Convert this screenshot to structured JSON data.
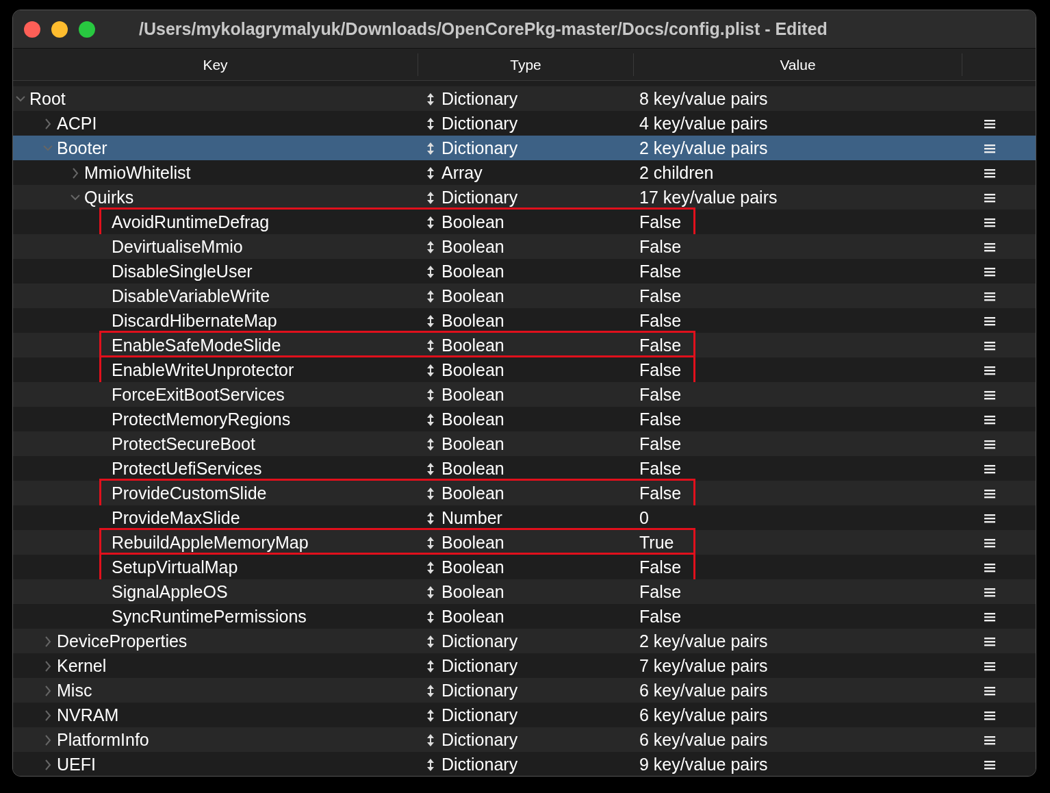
{
  "window": {
    "title": "/Users/mykolagrymalyuk/Downloads/OpenCorePkg-master/Docs/config.plist - Edited"
  },
  "table": {
    "columns": [
      "Key",
      "Type",
      "Value"
    ],
    "rows": [
      {
        "key": "Root",
        "type": "Dictionary",
        "value": "8 key/value pairs",
        "expanded": true,
        "selected": false,
        "highlighted": false,
        "children": [
          {
            "key": "ACPI",
            "type": "Dictionary",
            "value": "4 key/value pairs",
            "expanded": false,
            "selected": false,
            "highlighted": false
          },
          {
            "key": "Booter",
            "type": "Dictionary",
            "value": "2 key/value pairs",
            "expanded": true,
            "selected": true,
            "highlighted": false,
            "children": [
              {
                "key": "MmioWhitelist",
                "type": "Array",
                "value": "2 children",
                "expanded": false,
                "selected": false,
                "highlighted": false
              },
              {
                "key": "Quirks",
                "type": "Dictionary",
                "value": "17 key/value pairs",
                "expanded": true,
                "selected": false,
                "highlighted": false,
                "children": [
                  {
                    "key": "AvoidRuntimeDefrag",
                    "type": "Boolean",
                    "value": "False",
                    "selected": false,
                    "highlighted": true
                  },
                  {
                    "key": "DevirtualiseMmio",
                    "type": "Boolean",
                    "value": "False",
                    "selected": false,
                    "highlighted": false
                  },
                  {
                    "key": "DisableSingleUser",
                    "type": "Boolean",
                    "value": "False",
                    "selected": false,
                    "highlighted": false
                  },
                  {
                    "key": "DisableVariableWrite",
                    "type": "Boolean",
                    "value": "False",
                    "selected": false,
                    "highlighted": false
                  },
                  {
                    "key": "DiscardHibernateMap",
                    "type": "Boolean",
                    "value": "False",
                    "selected": false,
                    "highlighted": false
                  },
                  {
                    "key": "EnableSafeModeSlide",
                    "type": "Boolean",
                    "value": "False",
                    "selected": false,
                    "highlighted": true
                  },
                  {
                    "key": "EnableWriteUnprotector",
                    "type": "Boolean",
                    "value": "False",
                    "selected": false,
                    "highlighted": true
                  },
                  {
                    "key": "ForceExitBootServices",
                    "type": "Boolean",
                    "value": "False",
                    "selected": false,
                    "highlighted": false
                  },
                  {
                    "key": "ProtectMemoryRegions",
                    "type": "Boolean",
                    "value": "False",
                    "selected": false,
                    "highlighted": false
                  },
                  {
                    "key": "ProtectSecureBoot",
                    "type": "Boolean",
                    "value": "False",
                    "selected": false,
                    "highlighted": false
                  },
                  {
                    "key": "ProtectUefiServices",
                    "type": "Boolean",
                    "value": "False",
                    "selected": false,
                    "highlighted": false
                  },
                  {
                    "key": "ProvideCustomSlide",
                    "type": "Boolean",
                    "value": "False",
                    "selected": false,
                    "highlighted": true
                  },
                  {
                    "key": "ProvideMaxSlide",
                    "type": "Number",
                    "value": "0",
                    "selected": false,
                    "highlighted": false
                  },
                  {
                    "key": "RebuildAppleMemoryMap",
                    "type": "Boolean",
                    "value": "True",
                    "selected": false,
                    "highlighted": true
                  },
                  {
                    "key": "SetupVirtualMap",
                    "type": "Boolean",
                    "value": "False",
                    "selected": false,
                    "highlighted": true
                  },
                  {
                    "key": "SignalAppleOS",
                    "type": "Boolean",
                    "value": "False",
                    "selected": false,
                    "highlighted": false
                  },
                  {
                    "key": "SyncRuntimePermissions",
                    "type": "Boolean",
                    "value": "False",
                    "selected": false,
                    "highlighted": false
                  }
                ]
              }
            ]
          },
          {
            "key": "DeviceProperties",
            "type": "Dictionary",
            "value": "2 key/value pairs",
            "expanded": false,
            "selected": false,
            "highlighted": false
          },
          {
            "key": "Kernel",
            "type": "Dictionary",
            "value": "7 key/value pairs",
            "expanded": false,
            "selected": false,
            "highlighted": false
          },
          {
            "key": "Misc",
            "type": "Dictionary",
            "value": "6 key/value pairs",
            "expanded": false,
            "selected": false,
            "highlighted": false
          },
          {
            "key": "NVRAM",
            "type": "Dictionary",
            "value": "6 key/value pairs",
            "expanded": false,
            "selected": false,
            "highlighted": false
          },
          {
            "key": "PlatformInfo",
            "type": "Dictionary",
            "value": "6 key/value pairs",
            "expanded": false,
            "selected": false,
            "highlighted": false
          },
          {
            "key": "UEFI",
            "type": "Dictionary",
            "value": "9 key/value pairs",
            "expanded": false,
            "selected": false,
            "highlighted": false
          }
        ]
      }
    ]
  }
}
